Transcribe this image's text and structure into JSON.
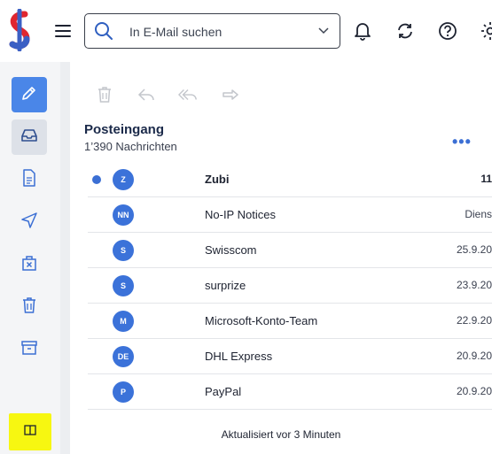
{
  "search": {
    "placeholder": "In E-Mail suchen"
  },
  "folder": {
    "title": "Posteingang",
    "count": "1’390 Nachrichten"
  },
  "messages": [
    {
      "initials": "Z",
      "sender": "Zubi",
      "date": "11",
      "unread": true
    },
    {
      "initials": "NN",
      "sender": "No-IP Notices",
      "date": "Diens",
      "unread": false
    },
    {
      "initials": "S",
      "sender": "Swisscom",
      "date": "25.9.20",
      "unread": false
    },
    {
      "initials": "S",
      "sender": "surprize",
      "date": "23.9.20",
      "unread": false
    },
    {
      "initials": "M",
      "sender": "Microsoft-Konto-Team",
      "date": "22.9.20",
      "unread": false
    },
    {
      "initials": "DE",
      "sender": "DHL Express",
      "date": "20.9.20",
      "unread": false
    },
    {
      "initials": "P",
      "sender": "PayPal",
      "date": "20.9.20",
      "unread": false
    }
  ],
  "status": {
    "text": "Aktualisiert vor 3 Minuten"
  },
  "colors": {
    "accent": "#3b72d9",
    "compose": "#4a86e8",
    "highlight": "#f7f711"
  },
  "icons": {
    "toolbar": [
      "trash-icon",
      "reply-icon",
      "reply-all-icon",
      "forward-icon"
    ],
    "topbar": [
      "bell-icon",
      "refresh-icon",
      "help-icon",
      "settings-icon"
    ],
    "sidebar": [
      "pencil-icon",
      "inbox-icon",
      "document-icon",
      "send-icon",
      "spam-icon",
      "trash-icon",
      "archive-icon",
      "panel-toggle-icon"
    ]
  }
}
